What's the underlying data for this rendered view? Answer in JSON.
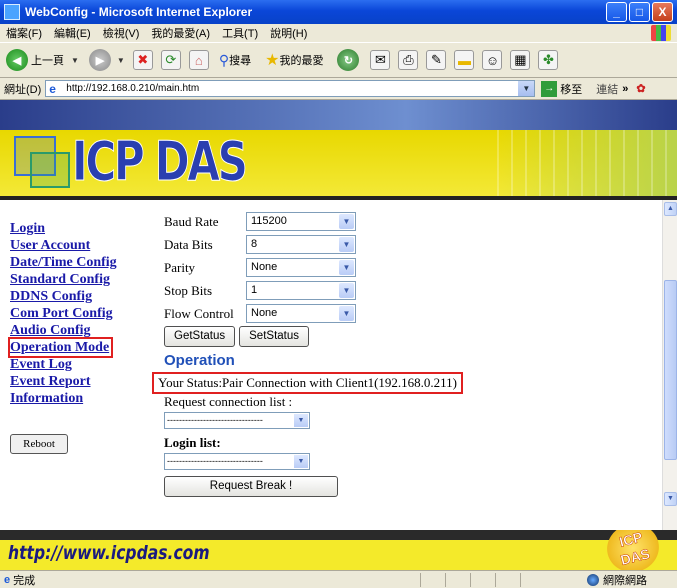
{
  "window": {
    "title": "WebConfig - Microsoft Internet Explorer",
    "controls": [
      "_",
      "□",
      "X"
    ]
  },
  "menubar": {
    "items": [
      "檔案(F)",
      "編輯(E)",
      "檢視(V)",
      "我的最愛(A)",
      "工具(T)",
      "說明(H)"
    ]
  },
  "toolbar": {
    "back_label": "上一頁",
    "search_label": "搜尋",
    "favorites_label": "我的最愛"
  },
  "address": {
    "label": "網址(D)",
    "url": "http://192.168.0.210/main.htm",
    "go_label": "移至",
    "links_label": "連結"
  },
  "banner": {
    "logo": "ICP DAS"
  },
  "nav": {
    "items": [
      "Login",
      "User Account",
      "Date/Time Config",
      "Standard Config",
      "DDNS Config",
      "Com Port Config",
      "Audio Config",
      "Operation Mode",
      "Event Log",
      "Event Report",
      "Information"
    ],
    "reboot_label": "Reboot"
  },
  "form": {
    "baud": {
      "label": "Baud Rate",
      "value": "115200"
    },
    "databits": {
      "label": "Data Bits",
      "value": "8"
    },
    "parity": {
      "label": "Parity",
      "value": "None"
    },
    "stopbits": {
      "label": "Stop Bits",
      "value": "1"
    },
    "flow": {
      "label": "Flow Control",
      "value": "None"
    },
    "get_label": "GetStatus",
    "set_label": "SetStatus",
    "operation_heading": "Operation",
    "status_text": "Your Status:Pair Connection with Client1(192.168.0.211)",
    "request_list_label": "Request connection list :",
    "request_list_value": "--------------------------------",
    "login_list_label": "Login list:",
    "login_list_value": "--------------------------------",
    "break_label": "Request Break !"
  },
  "footer": {
    "url": "http://www.icpdas.com",
    "badge": "ICP DAS"
  },
  "statusbar": {
    "text": "完成",
    "zone": "網際網路"
  }
}
